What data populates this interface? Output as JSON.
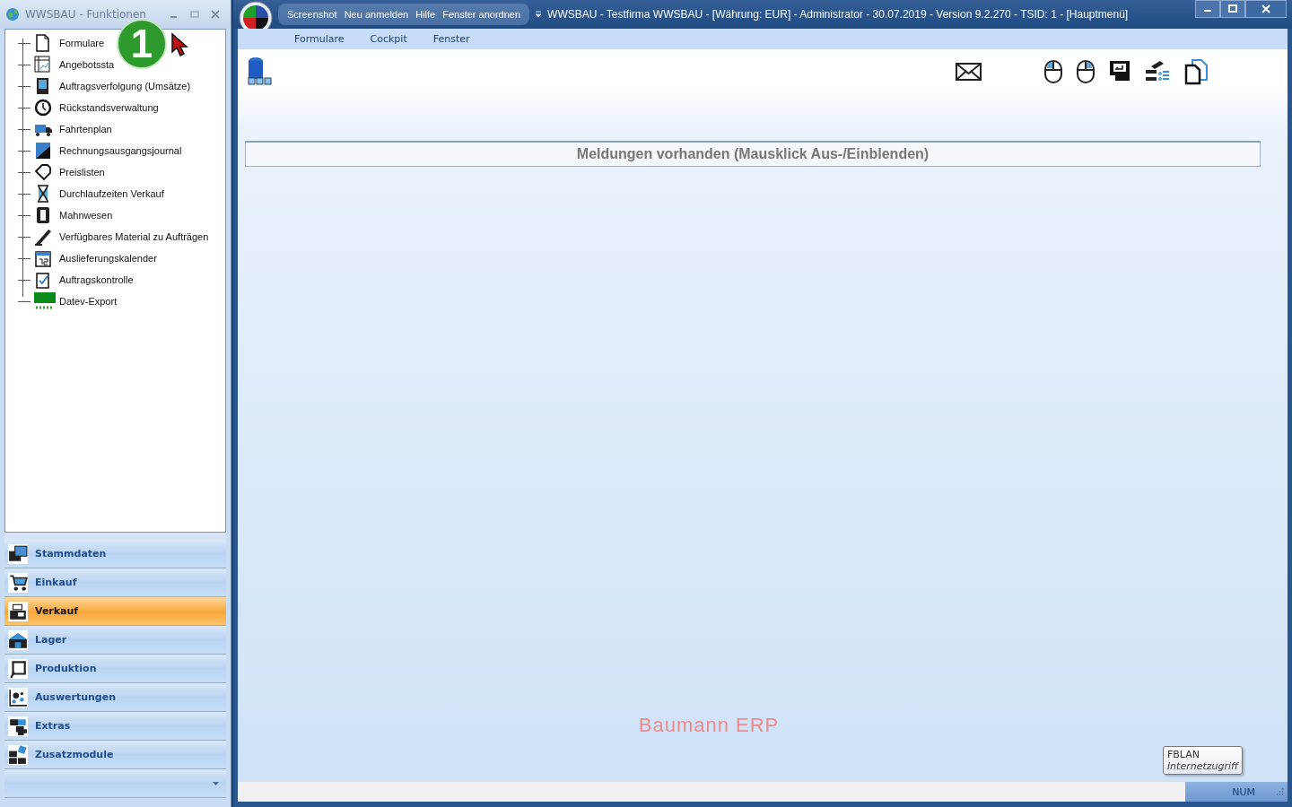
{
  "left_window": {
    "title": "WWSBAU - Funktionen",
    "tree": [
      {
        "label": "Formulare"
      },
      {
        "label": "Angebotssta"
      },
      {
        "label": "Auftragsverfolgung (Umsätze)"
      },
      {
        "label": "Rückstandsverwaltung"
      },
      {
        "label": "Fahrtenplan"
      },
      {
        "label": "Rechnungsausgangsjournal"
      },
      {
        "label": "Preislisten"
      },
      {
        "label": "Durchlaufzeiten Verkauf"
      },
      {
        "label": "Mahnwesen"
      },
      {
        "label": "Verfügbares Material zu Aufträgen"
      },
      {
        "label": "Auslieferungskalender"
      },
      {
        "label": "Auftragskontrolle"
      },
      {
        "label": "Datev-Export"
      }
    ],
    "nav": [
      {
        "label": "Stammdaten",
        "selected": false
      },
      {
        "label": "Einkauf",
        "selected": false
      },
      {
        "label": "Verkauf",
        "selected": true
      },
      {
        "label": "Lager",
        "selected": false
      },
      {
        "label": "Produktion",
        "selected": false
      },
      {
        "label": "Auswertungen",
        "selected": false
      },
      {
        "label": "Extras",
        "selected": false
      },
      {
        "label": "Zusatzmodule",
        "selected": false
      }
    ]
  },
  "callout": "1",
  "main_window": {
    "quick_access": [
      "Screenshot",
      "Neu anmelden",
      "Hilfe",
      "Fenster anordnen"
    ],
    "title": "WWSBAU - Testfirma WWSBAU - [Währung: EUR] - Administrator - 30.07.2019 - Version 9.2.270 - TSID: 1  - [Hauptmenü]",
    "menu": [
      "Formulare",
      "Cockpit",
      "Fenster"
    ],
    "message_bar": "Meldungen vorhanden  (Mausklick Aus-/Einblenden)",
    "brand_text": "Baumann ERP",
    "tooltip": {
      "title": "FBLAN",
      "subtitle": "Internetzugriff"
    },
    "status_bar": {
      "indicator": "NUM"
    }
  }
}
